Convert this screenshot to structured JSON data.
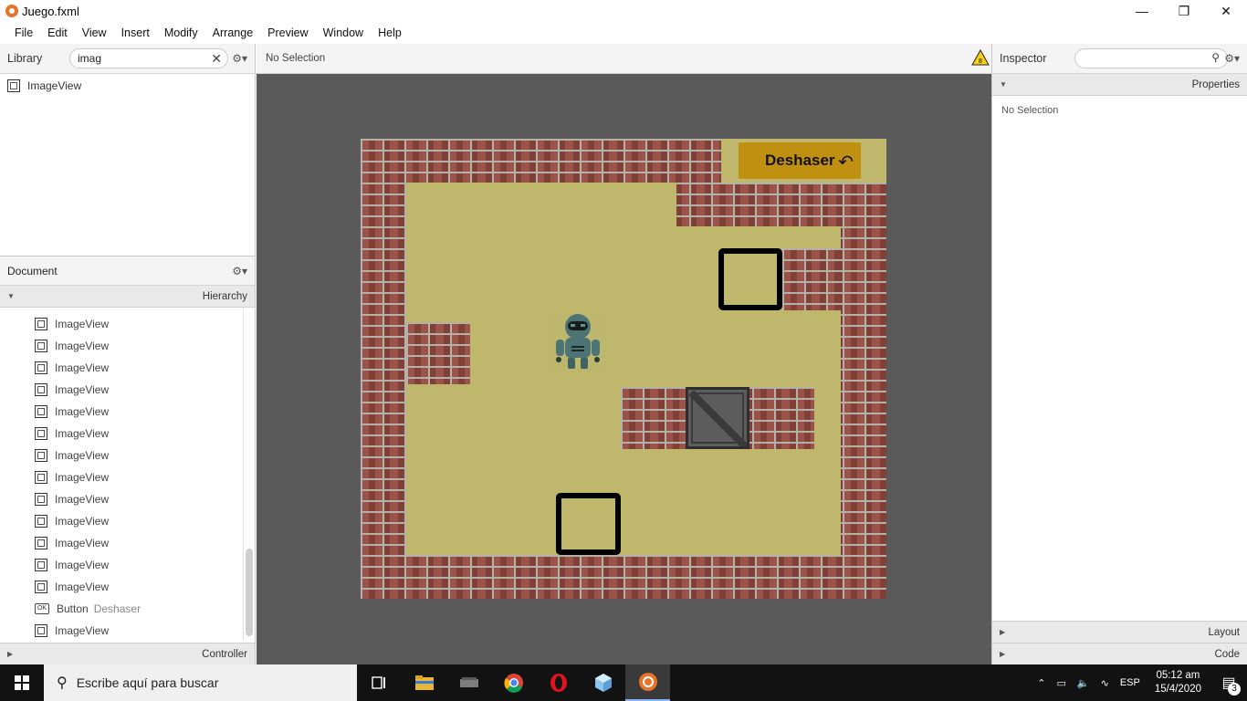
{
  "window": {
    "title": "Juego.fxml",
    "icons": {
      "app": "scene-builder-icon",
      "minimize": "minimize-icon",
      "maximize": "restore-icon",
      "close": "close-icon"
    }
  },
  "menubar": {
    "items": [
      "File",
      "Edit",
      "View",
      "Insert",
      "Modify",
      "Arrange",
      "Preview",
      "Window",
      "Help"
    ]
  },
  "library": {
    "title": "Library",
    "search_value": "imag",
    "results": [
      {
        "label": "ImageView",
        "icon": "imageview-icon"
      }
    ]
  },
  "document": {
    "title": "Document",
    "section": "Hierarchy",
    "items": [
      {
        "type": "ImageView",
        "sub": ""
      },
      {
        "type": "ImageView",
        "sub": ""
      },
      {
        "type": "ImageView",
        "sub": ""
      },
      {
        "type": "ImageView",
        "sub": ""
      },
      {
        "type": "ImageView",
        "sub": ""
      },
      {
        "type": "ImageView",
        "sub": ""
      },
      {
        "type": "ImageView",
        "sub": ""
      },
      {
        "type": "ImageView",
        "sub": ""
      },
      {
        "type": "ImageView",
        "sub": ""
      },
      {
        "type": "ImageView",
        "sub": ""
      },
      {
        "type": "ImageView",
        "sub": ""
      },
      {
        "type": "ImageView",
        "sub": ""
      },
      {
        "type": "ImageView",
        "sub": ""
      },
      {
        "type": "Button",
        "sub": "Deshaser"
      },
      {
        "type": "ImageView",
        "sub": ""
      }
    ],
    "controller_label": "Controller"
  },
  "content": {
    "selection_label": "No Selection",
    "warning_icon": "warning-icon",
    "undo_button_label": "Deshaser",
    "colors": {
      "floor": "#bfb76c",
      "brick": "#8f4b43",
      "button": "#c09010",
      "canvas": "#5a5a5a"
    }
  },
  "inspector": {
    "title": "Inspector",
    "section": "Properties",
    "empty_label": "No Selection",
    "layout_label": "Layout",
    "code_label": "Code"
  },
  "taskbar": {
    "search_placeholder": "Escribe aquí para buscar",
    "apps": [
      "task-view-icon",
      "file-explorer-icon",
      "terminal-icon",
      "chrome-icon",
      "opera-icon",
      "cube-app-icon",
      "scene-builder-icon"
    ],
    "tray": {
      "language": "ESP",
      "time": "05:12 am",
      "date": "15/4/2020",
      "notifications": "3"
    }
  }
}
